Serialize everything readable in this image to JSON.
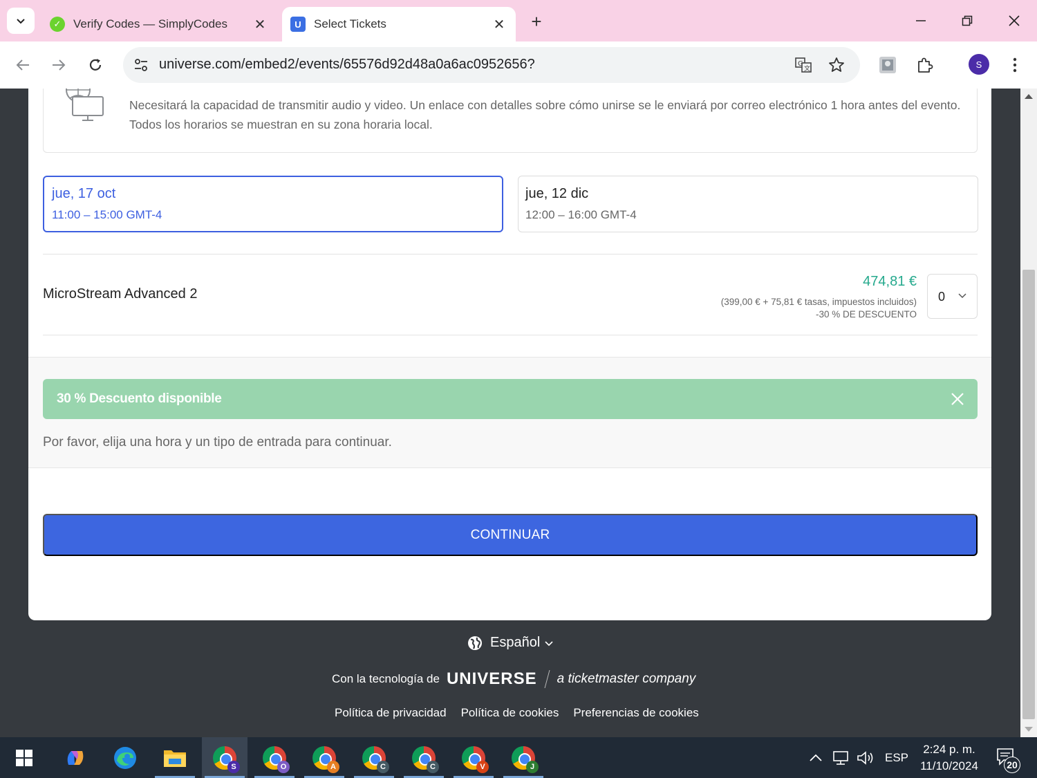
{
  "browser": {
    "tabs": [
      {
        "title": "Verify Codes — SimplyCodes",
        "favicon": "simplycodes-icon"
      },
      {
        "title": "Select Tickets",
        "favicon": "U"
      }
    ],
    "url": "universe.com/embed2/events/65576d92d48a0a6ac0952656?",
    "profile_initial": "S"
  },
  "event": {
    "info_text": "Necesitará la capacidad de transmitir audio y video. Un enlace con detalles sobre cómo unirse se le enviará por correo electrónico 1 hora antes del evento. Todos los horarios se muestran en su zona horaria local.",
    "dates": [
      {
        "title": "jue, 17 oct",
        "time": "11:00 – 15:00 GMT-4",
        "selected": true
      },
      {
        "title": "jue, 12 dic",
        "time": "12:00 – 16:00 GMT-4",
        "selected": false
      }
    ]
  },
  "ticket": {
    "name": "MicroStream Advanced 2",
    "price": "474,81 €",
    "breakdown": "(399,00 € + 75,81 € tasas, impuestos incluidos)",
    "discount_note": "-30 % DE DESCUENTO",
    "quantity": "0"
  },
  "discount_banner": {
    "text": "30 % Descuento disponible"
  },
  "hint": "Por favor, elija una hora y un tipo de entrada para continuar.",
  "continue_label": "CONTINUAR",
  "footer": {
    "language": "Español",
    "powered_by": "Con la tecnología de",
    "brand": "UNIVERSE",
    "company": "a ticketmaster company",
    "links": [
      "Política de privacidad",
      "Política de cookies",
      "Preferencias de cookies"
    ]
  },
  "taskbar": {
    "apps": [
      {
        "name": "windows-start-icon"
      },
      {
        "name": "copilot-icon"
      },
      {
        "name": "edge-icon"
      },
      {
        "name": "file-explorer-icon"
      },
      {
        "name": "chrome-icon",
        "badge": "S",
        "badge_color": "#4b2ca8",
        "active": true
      },
      {
        "name": "chrome-icon",
        "badge": "O",
        "badge_color": "#7c5cc4"
      },
      {
        "name": "chrome-icon",
        "badge": "A",
        "badge_color": "#e67e22"
      },
      {
        "name": "chrome-icon",
        "badge": "C",
        "badge_color": "#455a64"
      },
      {
        "name": "chrome-icon",
        "badge": "C",
        "badge_color": "#455a64"
      },
      {
        "name": "chrome-icon",
        "badge": "V",
        "badge_color": "#d84315"
      },
      {
        "name": "chrome-icon",
        "badge": "J",
        "badge_color": "#2e7d32"
      }
    ],
    "lang_indicator": "ESP",
    "time": "2:24 p. m.",
    "date": "11/10/2024",
    "notifications": "20"
  },
  "colors": {
    "accent": "#3d66e0",
    "price": "#25a98d",
    "discount_banner": "#99d5ae",
    "tabbar": "#f9d2e6"
  }
}
